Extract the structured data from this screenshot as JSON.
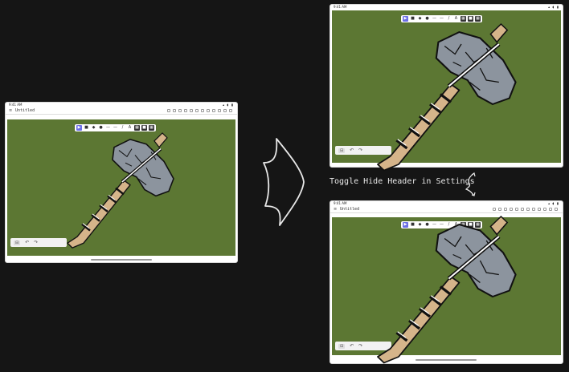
{
  "tablet": {
    "status_time": "9:41 AM",
    "status_icons": "▴ ◖ ▮",
    "app_title": "Untitled",
    "menu_glyph": "≡"
  },
  "toolbar": {
    "tools": [
      "▶",
      "■",
      "◆",
      "●",
      "—",
      "—",
      "/",
      "A",
      "▦",
      "■",
      "▦"
    ]
  },
  "bottom_panel": {
    "zoom_glyph": "⊟",
    "undo_glyph": "↶",
    "redo_glyph": "↷"
  },
  "caption": {
    "text": "Toggle Hide Header in Settings"
  },
  "colors": {
    "background": "#151515",
    "canvas": "#5c7733",
    "accent": "#6b6ee6"
  },
  "icons": [
    "play-arrow-icon",
    "hammer-drawing",
    "transform-arrow-icon",
    "curly-arrow-icon"
  ]
}
